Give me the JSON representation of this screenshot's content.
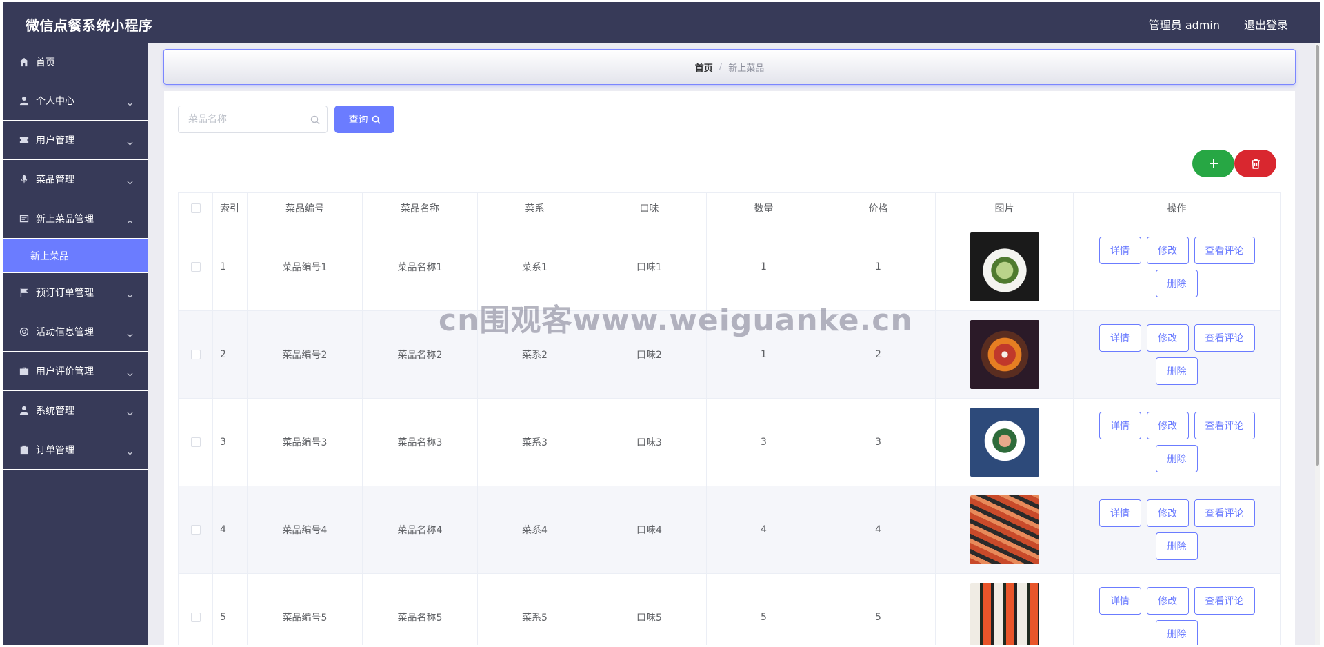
{
  "app": {
    "title": "微信点餐系统小程序",
    "user_label": "管理员 admin",
    "logout_label": "退出登录"
  },
  "sidebar": {
    "items": [
      {
        "label": "首页",
        "icon": "home-icon"
      },
      {
        "label": "个人中心",
        "icon": "user-icon"
      },
      {
        "label": "用户管理",
        "icon": "ticket-icon"
      },
      {
        "label": "菜品管理",
        "icon": "mic-icon"
      },
      {
        "label": "新上菜品管理",
        "icon": "card-icon",
        "expanded": true
      },
      {
        "label": "预订订单管理",
        "icon": "flag-icon"
      },
      {
        "label": "活动信息管理",
        "icon": "globe-icon"
      },
      {
        "label": "用户评价管理",
        "icon": "briefcase-icon"
      },
      {
        "label": "系统管理",
        "icon": "person-icon"
      },
      {
        "label": "订单管理",
        "icon": "clipboard-icon"
      }
    ],
    "active_sub": "新上菜品"
  },
  "breadcrumb": {
    "home": "首页",
    "separator": "/",
    "current": "新上菜品"
  },
  "search": {
    "placeholder": "菜品名称",
    "button_label": "查询"
  },
  "table": {
    "headers": [
      "索引",
      "菜品编号",
      "菜品名称",
      "菜系",
      "口味",
      "数量",
      "价格",
      "图片",
      "操作"
    ],
    "rows": [
      {
        "index": "1",
        "code": "菜品编号1",
        "name": "菜品名称1",
        "cuisine": "菜系1",
        "taste": "口味1",
        "qty": "1",
        "price": "1"
      },
      {
        "index": "2",
        "code": "菜品编号2",
        "name": "菜品名称2",
        "cuisine": "菜系2",
        "taste": "口味2",
        "qty": "1",
        "price": "2"
      },
      {
        "index": "3",
        "code": "菜品编号3",
        "name": "菜品名称3",
        "cuisine": "菜系3",
        "taste": "口味3",
        "qty": "3",
        "price": "3"
      },
      {
        "index": "4",
        "code": "菜品编号4",
        "name": "菜品名称4",
        "cuisine": "菜系4",
        "taste": "口味4",
        "qty": "4",
        "price": "4"
      },
      {
        "index": "5",
        "code": "菜品编号5",
        "name": "菜品名称5",
        "cuisine": "菜系5",
        "taste": "口味5",
        "qty": "5",
        "price": "5"
      }
    ],
    "actions": {
      "detail": "详情",
      "edit": "修改",
      "comments": "查看评论",
      "delete": "删除"
    }
  },
  "watermark": "cn围观客www.weiguanke.cn",
  "colors": {
    "sidebar": "#373a58",
    "accent": "#6b7cff",
    "add": "#27a744",
    "delete": "#d9272f"
  }
}
